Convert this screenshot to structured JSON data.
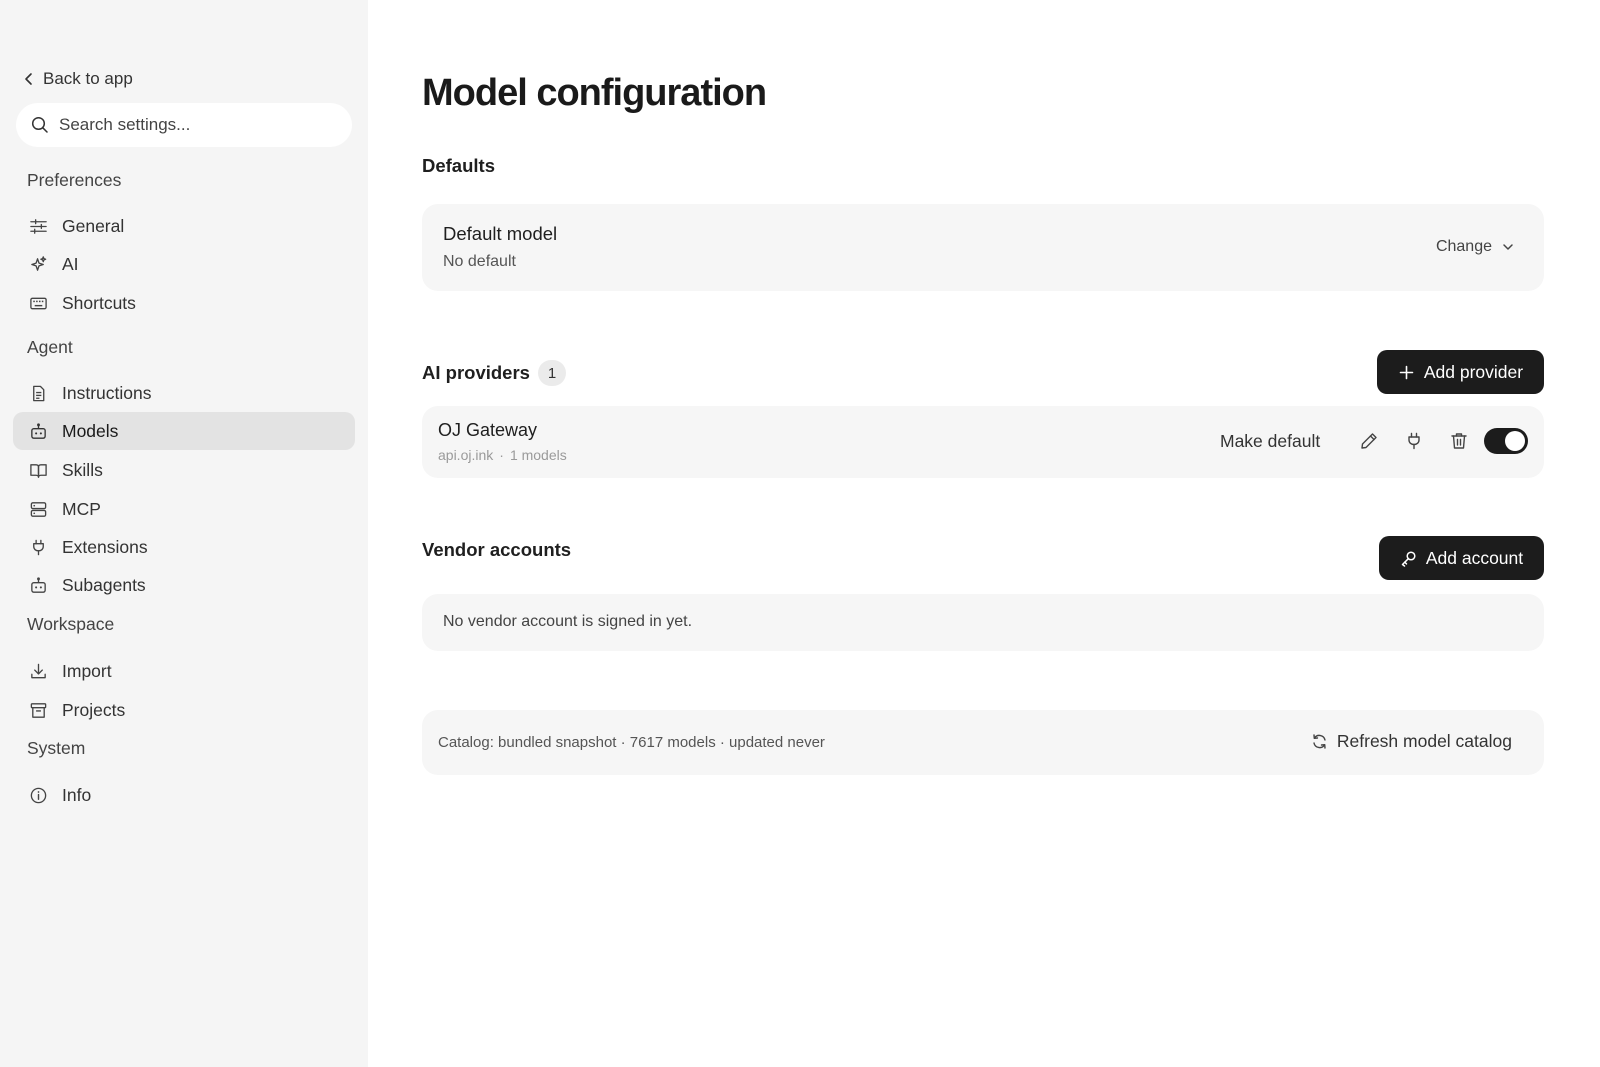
{
  "sidebar": {
    "back_label": "Back to app",
    "search_placeholder": "Search settings...",
    "sections": {
      "preferences": "Preferences",
      "agent": "Agent",
      "workspace": "Workspace",
      "system": "System"
    },
    "items": {
      "general": {
        "label": "General",
        "icon": "sliders-icon"
      },
      "ai": {
        "label": "AI",
        "icon": "sparkles-icon"
      },
      "shortcuts": {
        "label": "Shortcuts",
        "icon": "keyboard-icon"
      },
      "instructions": {
        "label": "Instructions",
        "icon": "document-icon"
      },
      "models": {
        "label": "Models",
        "icon": "bot-icon",
        "active": true
      },
      "skills": {
        "label": "Skills",
        "icon": "book-icon"
      },
      "mcp": {
        "label": "MCP",
        "icon": "server-icon"
      },
      "extensions": {
        "label": "Extensions",
        "icon": "plug-icon"
      },
      "subagents": {
        "label": "Subagents",
        "icon": "bot-icon"
      },
      "import": {
        "label": "Import",
        "icon": "download-icon"
      },
      "projects": {
        "label": "Projects",
        "icon": "archive-icon"
      },
      "info": {
        "label": "Info",
        "icon": "info-icon"
      }
    }
  },
  "main": {
    "title": "Model configuration",
    "defaults": {
      "heading": "Defaults",
      "default_model_label": "Default model",
      "default_model_value": "No default",
      "change_label": "Change"
    },
    "providers": {
      "heading": "AI providers",
      "count": "1",
      "add_label": "Add provider",
      "list": [
        {
          "name": "OJ Gateway",
          "host": "api.oj.ink",
          "separator": "·",
          "models": "1 models",
          "make_default_label": "Make default",
          "enabled": true
        }
      ]
    },
    "vendors": {
      "heading": "Vendor accounts",
      "add_label": "Add account",
      "empty_text": "No vendor account is signed in yet."
    },
    "catalog": {
      "text": "Catalog: bundled snapshot · 7617 models · updated never",
      "refresh_label": "Refresh model catalog"
    }
  },
  "colors": {
    "sidebar_bg": "#f5f5f5",
    "card_bg": "#f6f6f6",
    "active_item_bg": "#e3e3e3",
    "primary_button": "#1c1c1c"
  }
}
